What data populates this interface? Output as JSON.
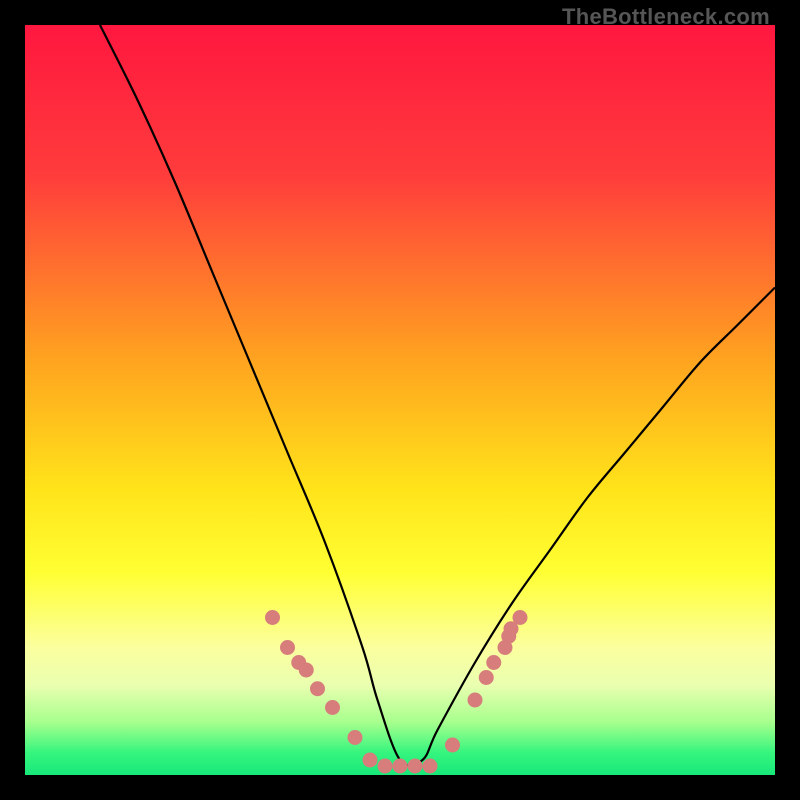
{
  "watermark": "TheBottleneck.com",
  "chart_data": {
    "type": "line",
    "title": "",
    "xlabel": "",
    "ylabel": "",
    "xlim": [
      0,
      100
    ],
    "ylim": [
      0,
      100
    ],
    "grid": false,
    "legend": false,
    "series": [
      {
        "name": "bottleneck-curve",
        "x": [
          10,
          15,
          20,
          25,
          30,
          35,
          40,
          45,
          47,
          50,
          53,
          55,
          60,
          65,
          70,
          75,
          80,
          85,
          90,
          95,
          100
        ],
        "y": [
          100,
          90,
          79,
          67,
          55,
          43,
          31,
          17,
          10,
          2,
          2,
          6,
          15,
          23,
          30,
          37,
          43,
          49,
          55,
          60,
          65
        ]
      }
    ],
    "markers": [
      {
        "x": 33,
        "y": 21
      },
      {
        "x": 35,
        "y": 17
      },
      {
        "x": 36.5,
        "y": 15
      },
      {
        "x": 37.5,
        "y": 14
      },
      {
        "x": 39,
        "y": 11.5
      },
      {
        "x": 41,
        "y": 9
      },
      {
        "x": 44,
        "y": 5
      },
      {
        "x": 46,
        "y": 2
      },
      {
        "x": 48,
        "y": 1.2
      },
      {
        "x": 50,
        "y": 1.2
      },
      {
        "x": 52,
        "y": 1.2
      },
      {
        "x": 54,
        "y": 1.2
      },
      {
        "x": 57,
        "y": 4
      },
      {
        "x": 60,
        "y": 10
      },
      {
        "x": 61.5,
        "y": 13
      },
      {
        "x": 62.5,
        "y": 15
      },
      {
        "x": 64,
        "y": 17
      },
      {
        "x": 64.5,
        "y": 18.5
      },
      {
        "x": 64.8,
        "y": 19.5
      },
      {
        "x": 66,
        "y": 21
      }
    ],
    "background_gradient": {
      "stops": [
        {
          "offset": 0.0,
          "color": "#ff173f"
        },
        {
          "offset": 0.2,
          "color": "#ff3c3c"
        },
        {
          "offset": 0.45,
          "color": "#ffa51f"
        },
        {
          "offset": 0.62,
          "color": "#ffe41a"
        },
        {
          "offset": 0.73,
          "color": "#ffff33"
        },
        {
          "offset": 0.83,
          "color": "#fbff9e"
        },
        {
          "offset": 0.88,
          "color": "#eaffb0"
        },
        {
          "offset": 0.93,
          "color": "#a6ff8d"
        },
        {
          "offset": 0.97,
          "color": "#36f57e"
        },
        {
          "offset": 1.0,
          "color": "#18e87a"
        }
      ]
    }
  }
}
